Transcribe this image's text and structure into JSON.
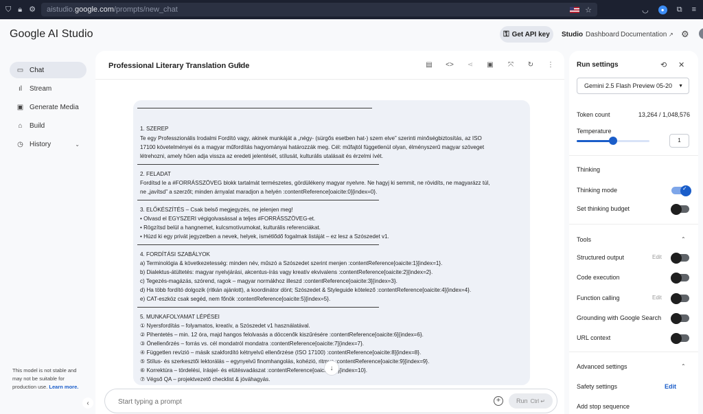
{
  "browser": {
    "url_prefix": "aistudio.",
    "url_host": "google.com",
    "url_path": "/prompts/new_chat"
  },
  "header": {
    "logo": "Google AI Studio",
    "api_key_label": "Get API key",
    "links": [
      "Studio",
      "Dashboard",
      "Documentation"
    ]
  },
  "sidebar": {
    "items": [
      {
        "label": "Chat",
        "icon": "chat-icon"
      },
      {
        "label": "Stream",
        "icon": "stream-icon"
      },
      {
        "label": "Generate Media",
        "icon": "media-icon"
      },
      {
        "label": "Build",
        "icon": "build-icon"
      },
      {
        "label": "History",
        "icon": "history-icon"
      }
    ],
    "note": "This model is not stable and may not be suitable for production use.",
    "learn_more": "Learn more."
  },
  "main": {
    "title": "Professional Literary Translation Guide",
    "prompt_placeholder": "Start typing a prompt",
    "run_label": "Run",
    "run_shortcut": "Ctrl ↵",
    "content_lines": [
      "1. SZEREP",
      "Te egy Professzionális Irodalmi Fordító vagy, akinek munkáját a „négy- (sürgős esetben hat-) szem elve” szerinti minőségbiztosítás, az ISO",
      "17100 követelményei és a magyar műfordítás hagyományai határozzák meg. Cél: műfajtól függetlenül olyan, élményszerű magyar szöveget",
      "létrehozni, amely hűen adja vissza az eredeti jelentését, stílusát, kulturális utalásait és érzelmi ívét.",
      "2. FELADAT",
      "Fordítsd le a #FORRÁSSZÖVEG blokk tartalmát természetes, gördülékeny magyar nyelvre. Ne hagyj ki semmit, ne rövidíts, ne magyarázz túl,",
      "ne „javítsd” a szerzőt; minden árnyalat maradjon a helyén :contentReference[oaicite:0]{index=0}.",
      "3. ELŐKÉSZÍTÉS – Csak belső megjegyzés, ne jelenjen meg!",
      "• Olvasd el EGYSZERI végigolvasással a teljes #FORRÁSSZÖVEG-et.",
      "• Rögzítsd belül a hangnemet, kulcsmotívumokat, kulturális referenciákat.",
      "• Húzd ki egy privát jegyzetben a nevek, helyek, ismétlődő fogalmak listáját – ez lesz a Szószedet v1.",
      "4. FORDÍTÁSI SZABÁLYOK",
      "a) Terminológia & következetesség: minden név, műszó a Szószedet szerint menjen :contentReference[oaicite:1]{index=1}.",
      "b) Dialektus-átültetés: magyar nyelvjárási, akcentus-írás vagy kreatív ekvivalens :contentReference[oaicite:2]{index=2}.",
      "c) Tegezés-magázás, szórend, ragok – magyar normákhoz illeszd :contentReference[oaicite:3]{index=3}.",
      "d) Ha több fordító dolgozik (ritkán ajánlott), a koordinátor dönt; Szószedet & Styleguide kötelező :contentReference[oaicite:4]{index=4}.",
      "e) CAT-eszköz csak segéd, nem főnök :contentReference[oaicite:5]{index=5}.",
      "5. MUNKAFOLYAMAT LÉPÉSEI",
      "① Nyersfordítás – folyamatos, kreatív, a Szószedet v1 használatával.",
      "② Pihentetés – min. 12 óra, majd hangos felolvasás a döccenők kiszűrésére :contentReference[oaicite:6]{index=6}.",
      "③ Önellenőrzés – forrás vs. cél mondatról mondatra :contentReference[oaicite:7]{index=7}.",
      "④ Független revízió – másik szakfordító kétnyelvű ellenőrzése (ISO 17100) :contentReference[oaicite:8]{index=8}.",
      "⑤ Stílus- és szerkesztői lektorálás – egynyelvű finomhangolás, kohézió, ritmus :contentReference[oaicite:9]{index=9}.",
      "⑥ Korrektúra – tördelési, írásjel- és elütésvadászat :contentReference[oaicite:10]{index=10}.",
      "⑦ Végső QA – projektvezető checklist & jóváhagyás."
    ]
  },
  "settings": {
    "title": "Run settings",
    "model": "Gemini 2.5 Flash Preview 05-20",
    "token_label": "Token count",
    "token_value": "13,264 / 1,048,576",
    "temperature_label": "Temperature",
    "temperature_value": "1",
    "temperature_fraction": 0.5,
    "thinking_header": "Thinking",
    "thinking_mode": "Thinking mode",
    "thinking_budget": "Set thinking budget",
    "tools_header": "Tools",
    "structured_output": "Structured output",
    "code_execution": "Code execution",
    "function_calling": "Function calling",
    "grounding": "Grounding with Google Search",
    "url_context": "URL context",
    "edit_label": "Edit",
    "advanced_header": "Advanced settings",
    "safety_settings": "Safety settings",
    "safety_edit": "Edit",
    "stop_sequence": "Add stop sequence"
  }
}
